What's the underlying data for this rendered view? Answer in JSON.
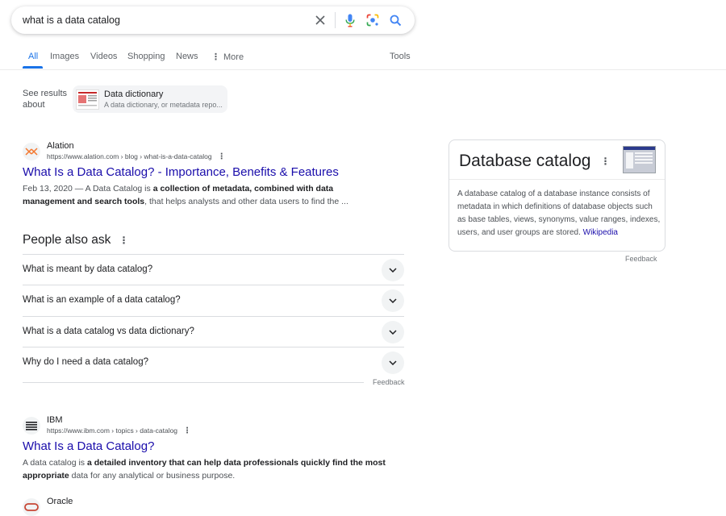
{
  "search": {
    "query": "what is a data catalog"
  },
  "tabs": [
    {
      "label": "All"
    },
    {
      "label": "Images"
    },
    {
      "label": "Videos"
    },
    {
      "label": "Shopping"
    },
    {
      "label": "News"
    },
    {
      "label": "More"
    }
  ],
  "tools_label": "Tools",
  "see_results": {
    "label_line1": "See results",
    "label_line2": "about",
    "title": "Data dictionary",
    "subtitle": "A data dictionary, or metadata repo..."
  },
  "results": [
    {
      "site": "Alation",
      "url": "https://www.alation.com › blog › what-is-a-data-catalog",
      "title": "What Is a Data Catalog? - Importance, Benefits & Features",
      "date_prefix": "Feb 13, 2020 — A Data Catalog is ",
      "bold1": "a collection of metadata, combined with data management and search tools",
      "rest": ", that helps analysts and other data users to find the ..."
    },
    {
      "site": "IBM",
      "url": "https://www.ibm.com › topics › data-catalog",
      "title": "What Is a Data Catalog?",
      "prefix": "A data catalog is ",
      "bold1": "a detailed inventory that can help data professionals quickly find the most appropriate",
      "rest": " data for any analytical or business purpose."
    },
    {
      "site": "Oracle"
    }
  ],
  "paa": {
    "heading": "People also ask",
    "questions": [
      "What is meant by data catalog?",
      "What is an example of a data catalog?",
      "What is a data catalog vs data dictionary?",
      "Why do I need a data catalog?"
    ],
    "feedback": "Feedback"
  },
  "knowledge_panel": {
    "title": "Database catalog",
    "description": "A database catalog of a database instance consists of metadata in which definitions of database objects such as base tables, views, synonyms, value ranges, indexes, users, and user groups are stored. ",
    "source_link": "Wikipedia",
    "feedback": "Feedback"
  },
  "colors": {
    "link": "#1a0dab",
    "accent": "#1a73e8",
    "text": "#202124",
    "muted": "#4d5156"
  }
}
